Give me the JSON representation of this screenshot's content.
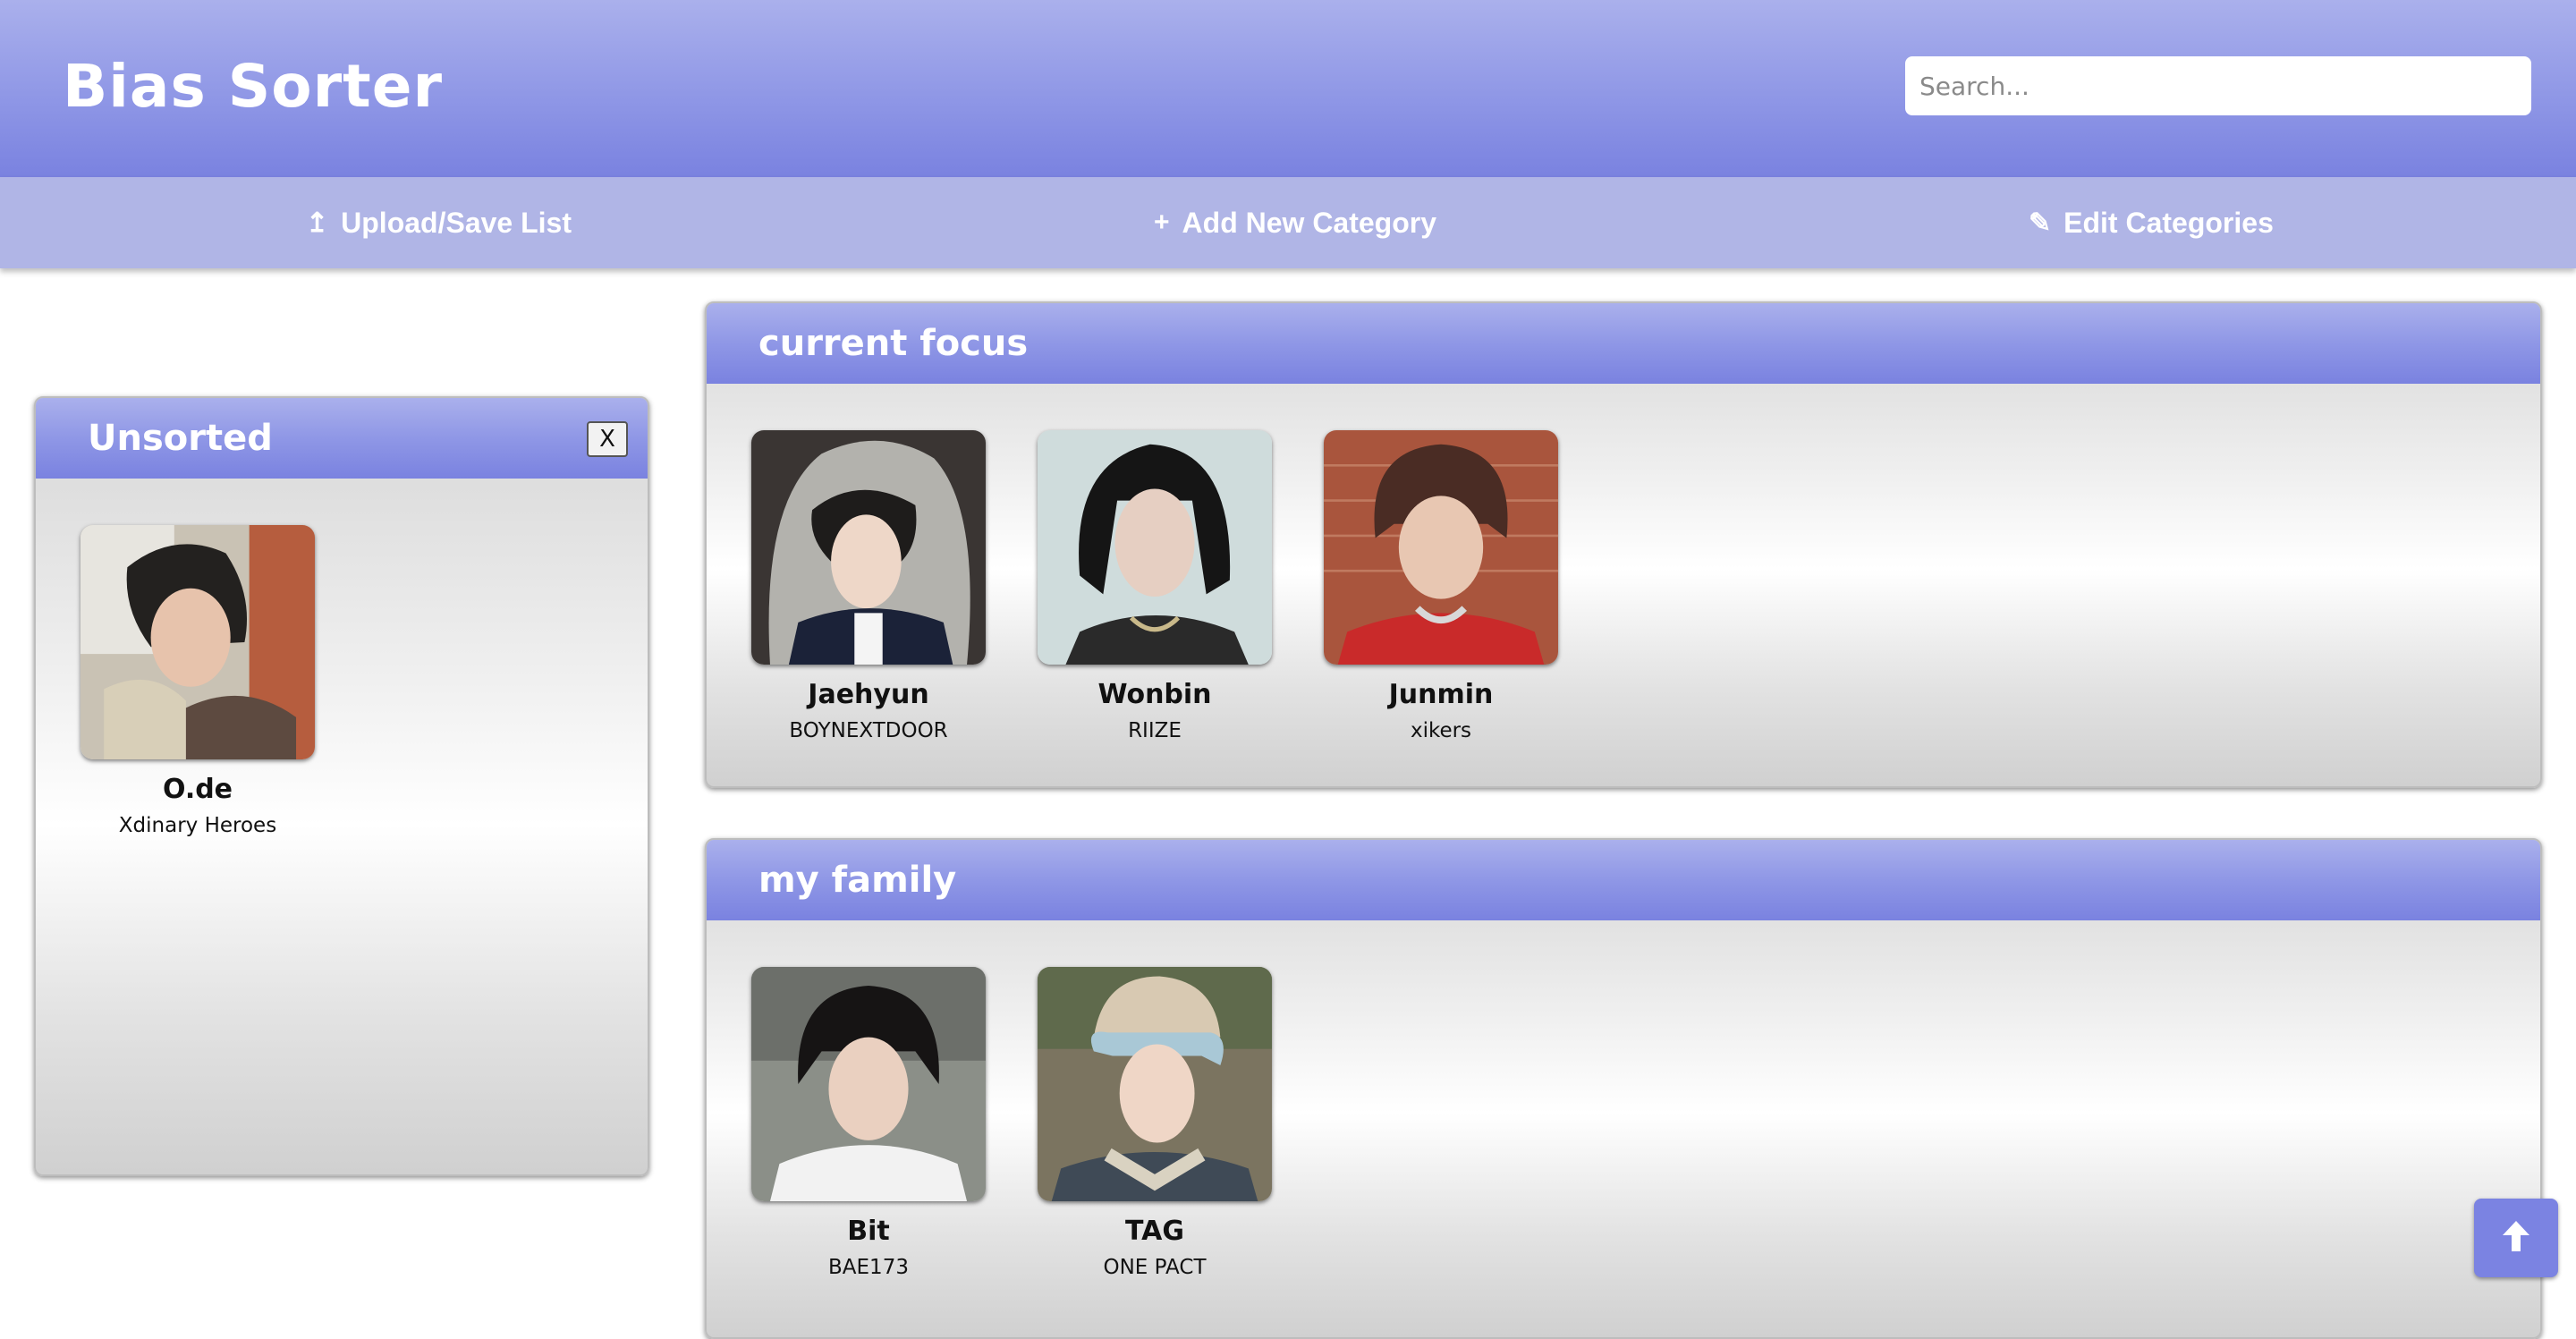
{
  "app": {
    "title": "Bias Sorter"
  },
  "search": {
    "placeholder": "Search..."
  },
  "nav": {
    "upload": {
      "icon": "upload-icon",
      "label": "Upload/Save List"
    },
    "add": {
      "icon": "plus-icon",
      "label": "Add New Category"
    },
    "edit": {
      "icon": "pencil-icon",
      "label": "Edit Categories"
    }
  },
  "unsorted": {
    "title": "Unsorted",
    "close_label": "X",
    "cards": [
      {
        "name": "O.de",
        "group": "Xdinary Heroes"
      }
    ]
  },
  "categories": [
    {
      "title": "current focus",
      "cards": [
        {
          "name": "Jaehyun",
          "group": "BOYNEXTDOOR"
        },
        {
          "name": "Wonbin",
          "group": "RIIZE"
        },
        {
          "name": "Junmin",
          "group": "xikers"
        }
      ]
    },
    {
      "title": "my family",
      "cards": [
        {
          "name": "Bit",
          "group": "BAE173"
        },
        {
          "name": "TAG",
          "group": "ONE PACT"
        }
      ]
    }
  ],
  "scroll_top": {
    "icon": "arrow-up-icon"
  },
  "colors": {
    "accent": "#7b83e2",
    "nav_bg": "#b0b5e6",
    "header_light": "#aab0ec"
  }
}
